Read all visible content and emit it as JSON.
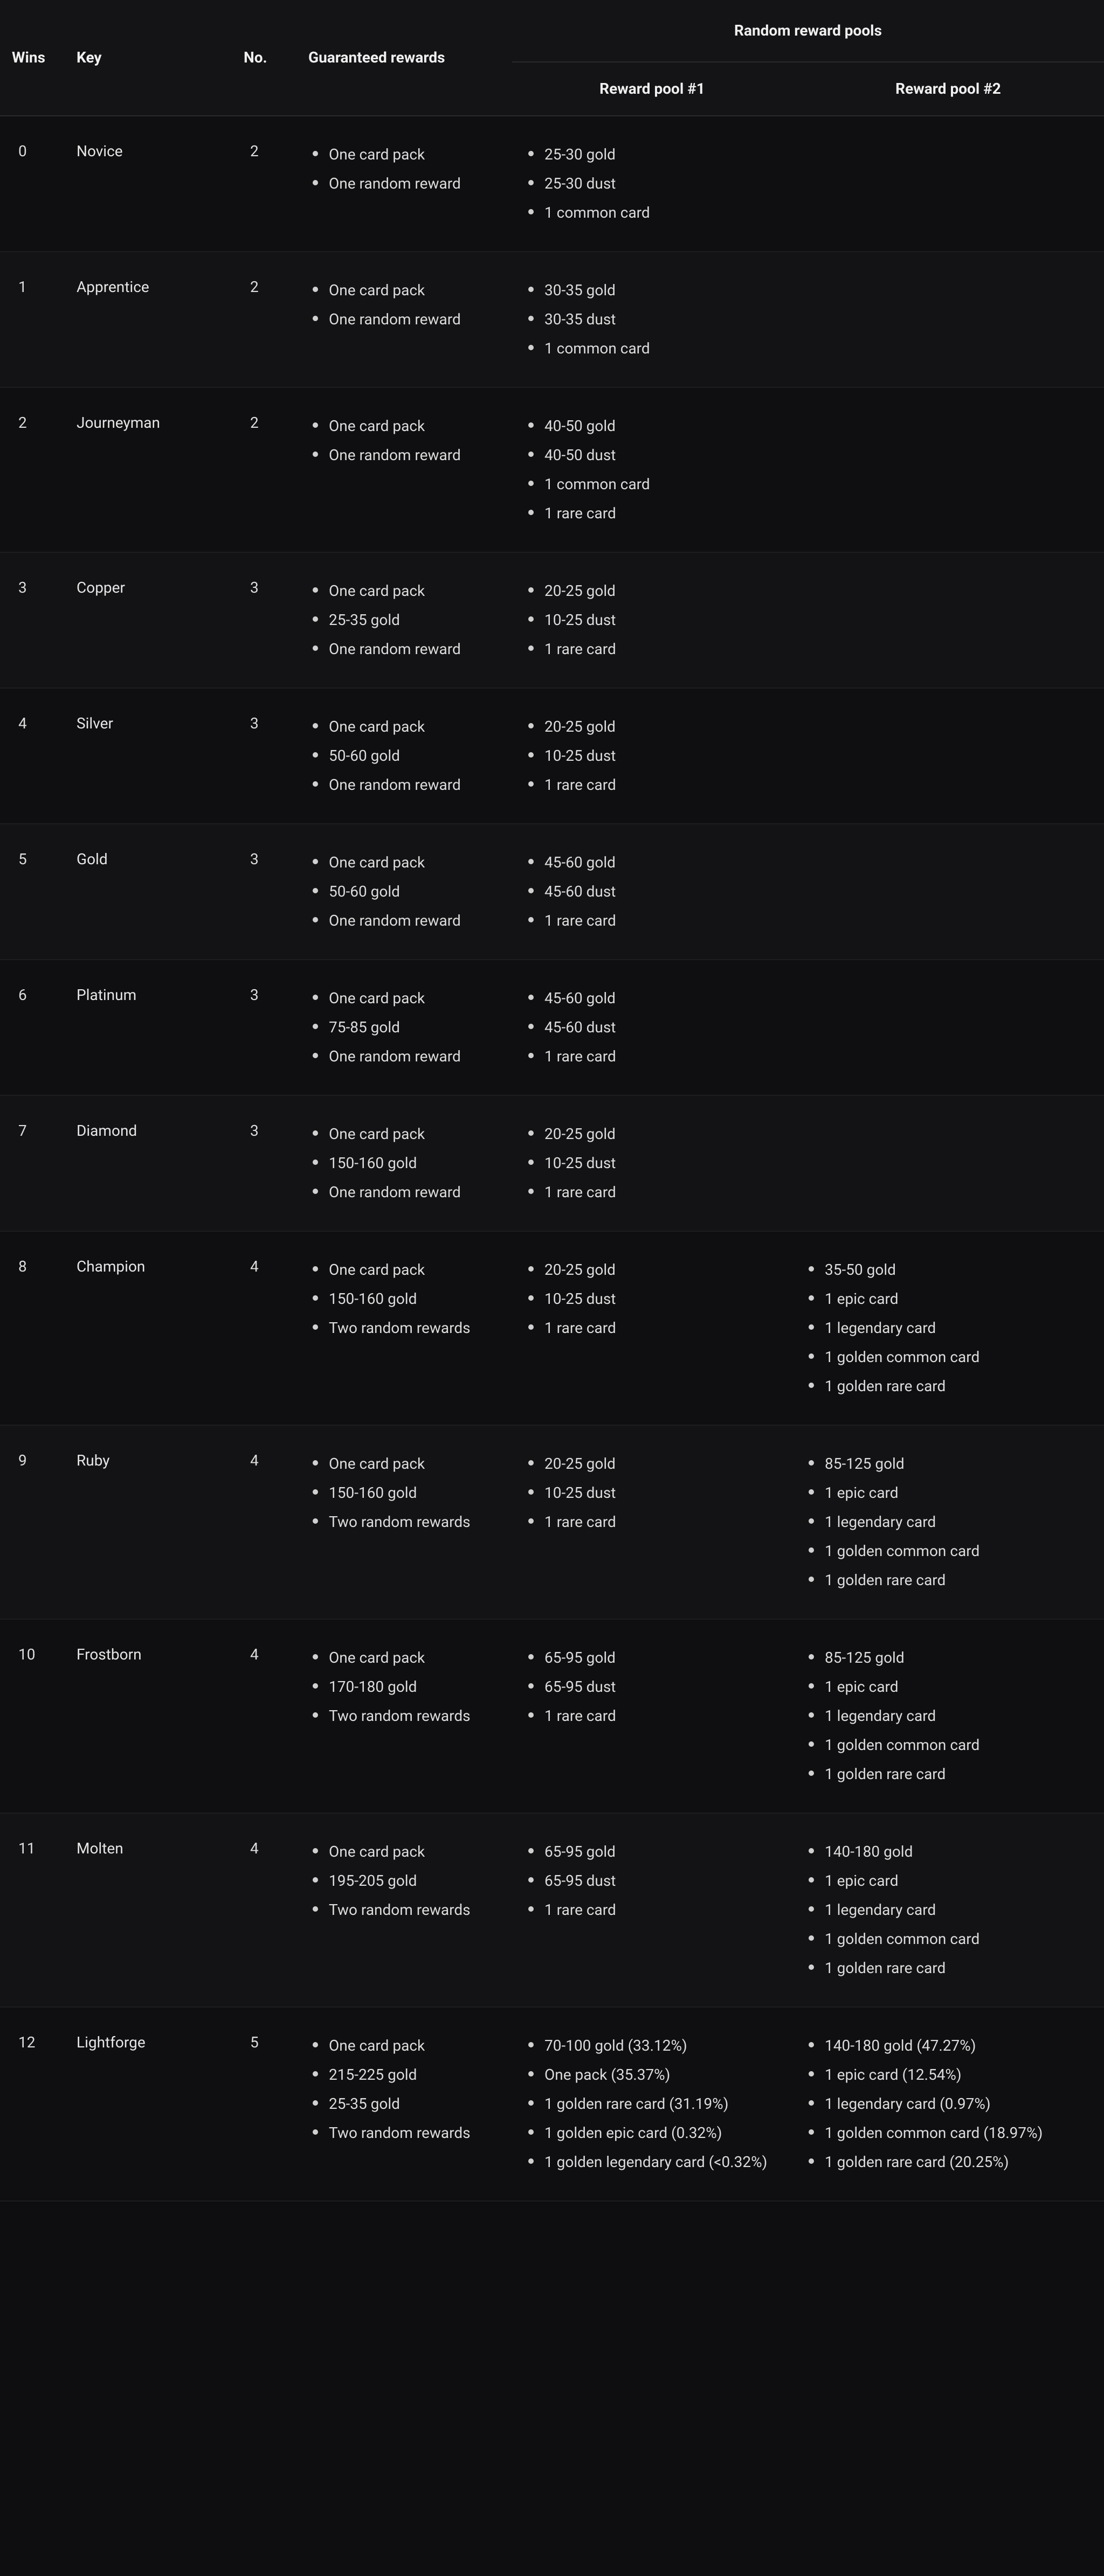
{
  "headers": {
    "wins": "Wins",
    "key": "Key",
    "no": "No.",
    "guaranteed": "Guaranteed rewards",
    "random_pools": "Random reward pools",
    "pool1": "Reward pool #1",
    "pool2": "Reward pool #2"
  },
  "rows": [
    {
      "wins": "0",
      "key": "Novice",
      "no": "2",
      "guaranteed": [
        "One card pack",
        "One random reward"
      ],
      "pool1": [
        "25-30 gold",
        "25-30 dust",
        "1 common card"
      ],
      "pool2": []
    },
    {
      "wins": "1",
      "key": "Apprentice",
      "no": "2",
      "guaranteed": [
        "One card pack",
        "One random reward"
      ],
      "pool1": [
        "30-35 gold",
        "30-35 dust",
        "1 common card"
      ],
      "pool2": []
    },
    {
      "wins": "2",
      "key": "Journeyman",
      "no": "2",
      "guaranteed": [
        "One card pack",
        "One random reward"
      ],
      "pool1": [
        "40-50 gold",
        "40-50 dust",
        "1 common card",
        "1 rare card"
      ],
      "pool2": []
    },
    {
      "wins": "3",
      "key": "Copper",
      "no": "3",
      "guaranteed": [
        "One card pack",
        "25-35 gold",
        "One random reward"
      ],
      "pool1": [
        "20-25 gold",
        "10-25 dust",
        "1 rare card"
      ],
      "pool2": []
    },
    {
      "wins": "4",
      "key": "Silver",
      "no": "3",
      "guaranteed": [
        "One card pack",
        "50-60 gold",
        "One random reward"
      ],
      "pool1": [
        "20-25 gold",
        "10-25 dust",
        "1 rare card"
      ],
      "pool2": []
    },
    {
      "wins": "5",
      "key": "Gold",
      "no": "3",
      "guaranteed": [
        "One card pack",
        "50-60 gold",
        "One random reward"
      ],
      "pool1": [
        "45-60 gold",
        "45-60 dust",
        "1 rare card"
      ],
      "pool2": []
    },
    {
      "wins": "6",
      "key": "Platinum",
      "no": "3",
      "guaranteed": [
        "One card pack",
        "75-85 gold",
        "One random reward"
      ],
      "pool1": [
        "45-60 gold",
        "45-60 dust",
        "1 rare card"
      ],
      "pool2": []
    },
    {
      "wins": "7",
      "key": "Diamond",
      "no": "3",
      "guaranteed": [
        "One card pack",
        "150-160 gold",
        "One random reward"
      ],
      "pool1": [
        "20-25 gold",
        "10-25 dust",
        "1 rare card"
      ],
      "pool2": []
    },
    {
      "wins": "8",
      "key": "Champion",
      "no": "4",
      "guaranteed": [
        "One card pack",
        "150-160 gold",
        "Two random rewards"
      ],
      "pool1": [
        "20-25 gold",
        "10-25 dust",
        "1 rare card"
      ],
      "pool2": [
        "35-50 gold",
        "1 epic card",
        "1 legendary card",
        "1 golden common card",
        "1 golden rare card"
      ]
    },
    {
      "wins": "9",
      "key": "Ruby",
      "no": "4",
      "guaranteed": [
        "One card pack",
        "150-160 gold",
        "Two random rewards"
      ],
      "pool1": [
        "20-25 gold",
        "10-25 dust",
        "1 rare card"
      ],
      "pool2": [
        "85-125 gold",
        "1 epic card",
        "1 legendary card",
        "1 golden common card",
        "1 golden rare card"
      ]
    },
    {
      "wins": "10",
      "key": "Frostborn",
      "no": "4",
      "guaranteed": [
        "One card pack",
        "170-180 gold",
        "Two random rewards"
      ],
      "pool1": [
        "65-95 gold",
        "65-95 dust",
        "1 rare card"
      ],
      "pool2": [
        "85-125 gold",
        "1 epic card",
        "1 legendary card",
        "1 golden common card",
        "1 golden rare card"
      ]
    },
    {
      "wins": "11",
      "key": "Molten",
      "no": "4",
      "guaranteed": [
        "One card pack",
        "195-205 gold",
        "Two random rewards"
      ],
      "pool1": [
        "65-95 gold",
        "65-95 dust",
        "1 rare card"
      ],
      "pool2": [
        "140-180 gold",
        "1 epic card",
        "1 legendary card",
        "1 golden common card",
        "1 golden rare card"
      ]
    },
    {
      "wins": "12",
      "key": "Lightforge",
      "no": "5",
      "guaranteed": [
        "One card pack",
        "215-225 gold",
        "25-35 gold",
        "Two random rewards"
      ],
      "pool1": [
        "70-100 gold (33.12%)",
        "One pack (35.37%)",
        "1 golden rare card (31.19%)",
        "1 golden epic card (0.32%)",
        "1 golden legendary card (<0.32%)"
      ],
      "pool2": [
        "140-180 gold (47.27%)",
        "1 epic card (12.54%)",
        "1 legendary card (0.97%)",
        "1 golden common card (18.97%)",
        "1 golden rare card (20.25%)"
      ]
    }
  ]
}
